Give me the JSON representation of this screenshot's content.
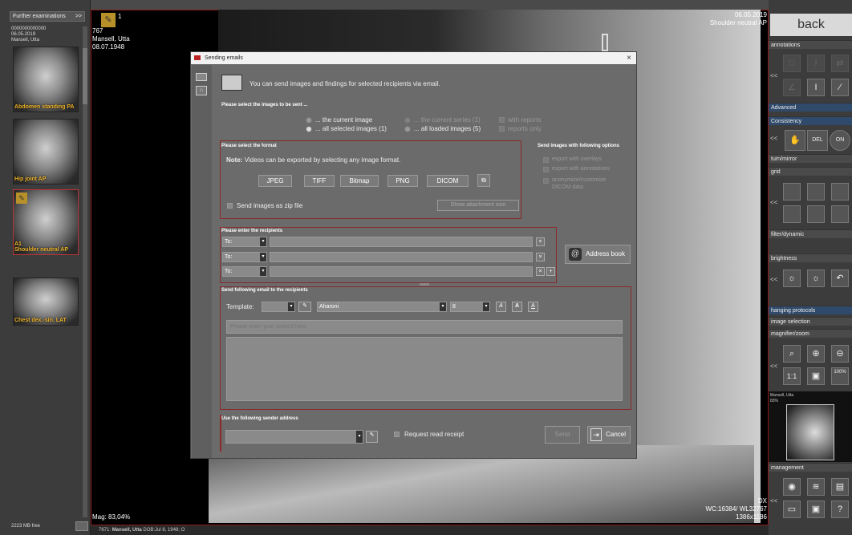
{
  "left": {
    "further_btn": "Further examinations",
    "further_chev": ">>",
    "patient_code": "0000000000000",
    "patient_date": "06.05.2019",
    "patient_name": "Mansell, Utta",
    "thumbs": [
      {
        "label": "Abdomen standing PA"
      },
      {
        "label": "Hip joint AP"
      },
      {
        "label": "A1\nShoulder neutral AP"
      },
      {
        "label": "Chest dex.-sin. LAT"
      }
    ],
    "free": "2223 MB free"
  },
  "viewer": {
    "number": "1",
    "id": "767",
    "name": "Mansell, Utta",
    "dob": "08.07.1948",
    "date": "06.05.2019",
    "series": "Shoulder neutral AP",
    "mag": "Mag: 83,04%",
    "modality": "DX",
    "wcwl": "WC:16384/ WL32767",
    "dims": "1386x1186",
    "status_prefix": "7671:",
    "status_name": "Mansell, Utta",
    "status_dob": "DOB:Jul 8, 1948; O"
  },
  "right": {
    "back": "back",
    "annotations": "annotations",
    "advanced": "Advanced",
    "consistency": "Consistency",
    "turn": "turn/mirror",
    "grid": "grid",
    "filter": "filter/dynamic",
    "brightness": "brightness",
    "hanging": "hanging protocols",
    "image_selection": "image selection",
    "magnifier": "magnifier/zoom",
    "zoom_11": "1:1",
    "zoom_100": "100%",
    "mini_name": "Mansell, Utta",
    "mini_zoom": "83%",
    "management": "management",
    "chev_left": "<<",
    "del_label": "DEL",
    "on_label": "ON"
  },
  "dialog": {
    "title": "Sending emails",
    "close": "×",
    "intro": "You can send images and findings for selected recipients via email.",
    "images_title": "Please select the images to be sent ...",
    "opt_current_image": "... the current image",
    "opt_current_series": "... the current series (1)",
    "opt_selected": "... all selected images (1)",
    "opt_loaded": "... all loaded images (5)",
    "opt_with_reports": "with reports",
    "opt_reports_only": "reports only",
    "format_title": "Please select the format",
    "note_label": "Note:",
    "note_text": "Videos can be exported by selecting any image format.",
    "formats": [
      "JPEG",
      "TIFF",
      "Bitmap",
      "PNG",
      "DICOM"
    ],
    "zip_label": "Send images as zip file",
    "show_size": "Show attachment size",
    "options_title": "Send images with following options",
    "opt_overlays": "export with overlays",
    "opt_annotations": "export with annotations",
    "opt_anonymize": "anonymize/customize DICOM data",
    "recipients_title": "Please enter the recipients",
    "to_label": "To:",
    "address_book": "Address book",
    "email_title": "Send following email to the recipients",
    "template_label": "Template:",
    "font_name": "Aharoni",
    "font_size": "8",
    "subject_placeholder": "Please enter your subject here",
    "sender_title": "Use the following sender address",
    "read_receipt": "Request read receipt",
    "send": "Send",
    "cancel": "Cancel"
  }
}
